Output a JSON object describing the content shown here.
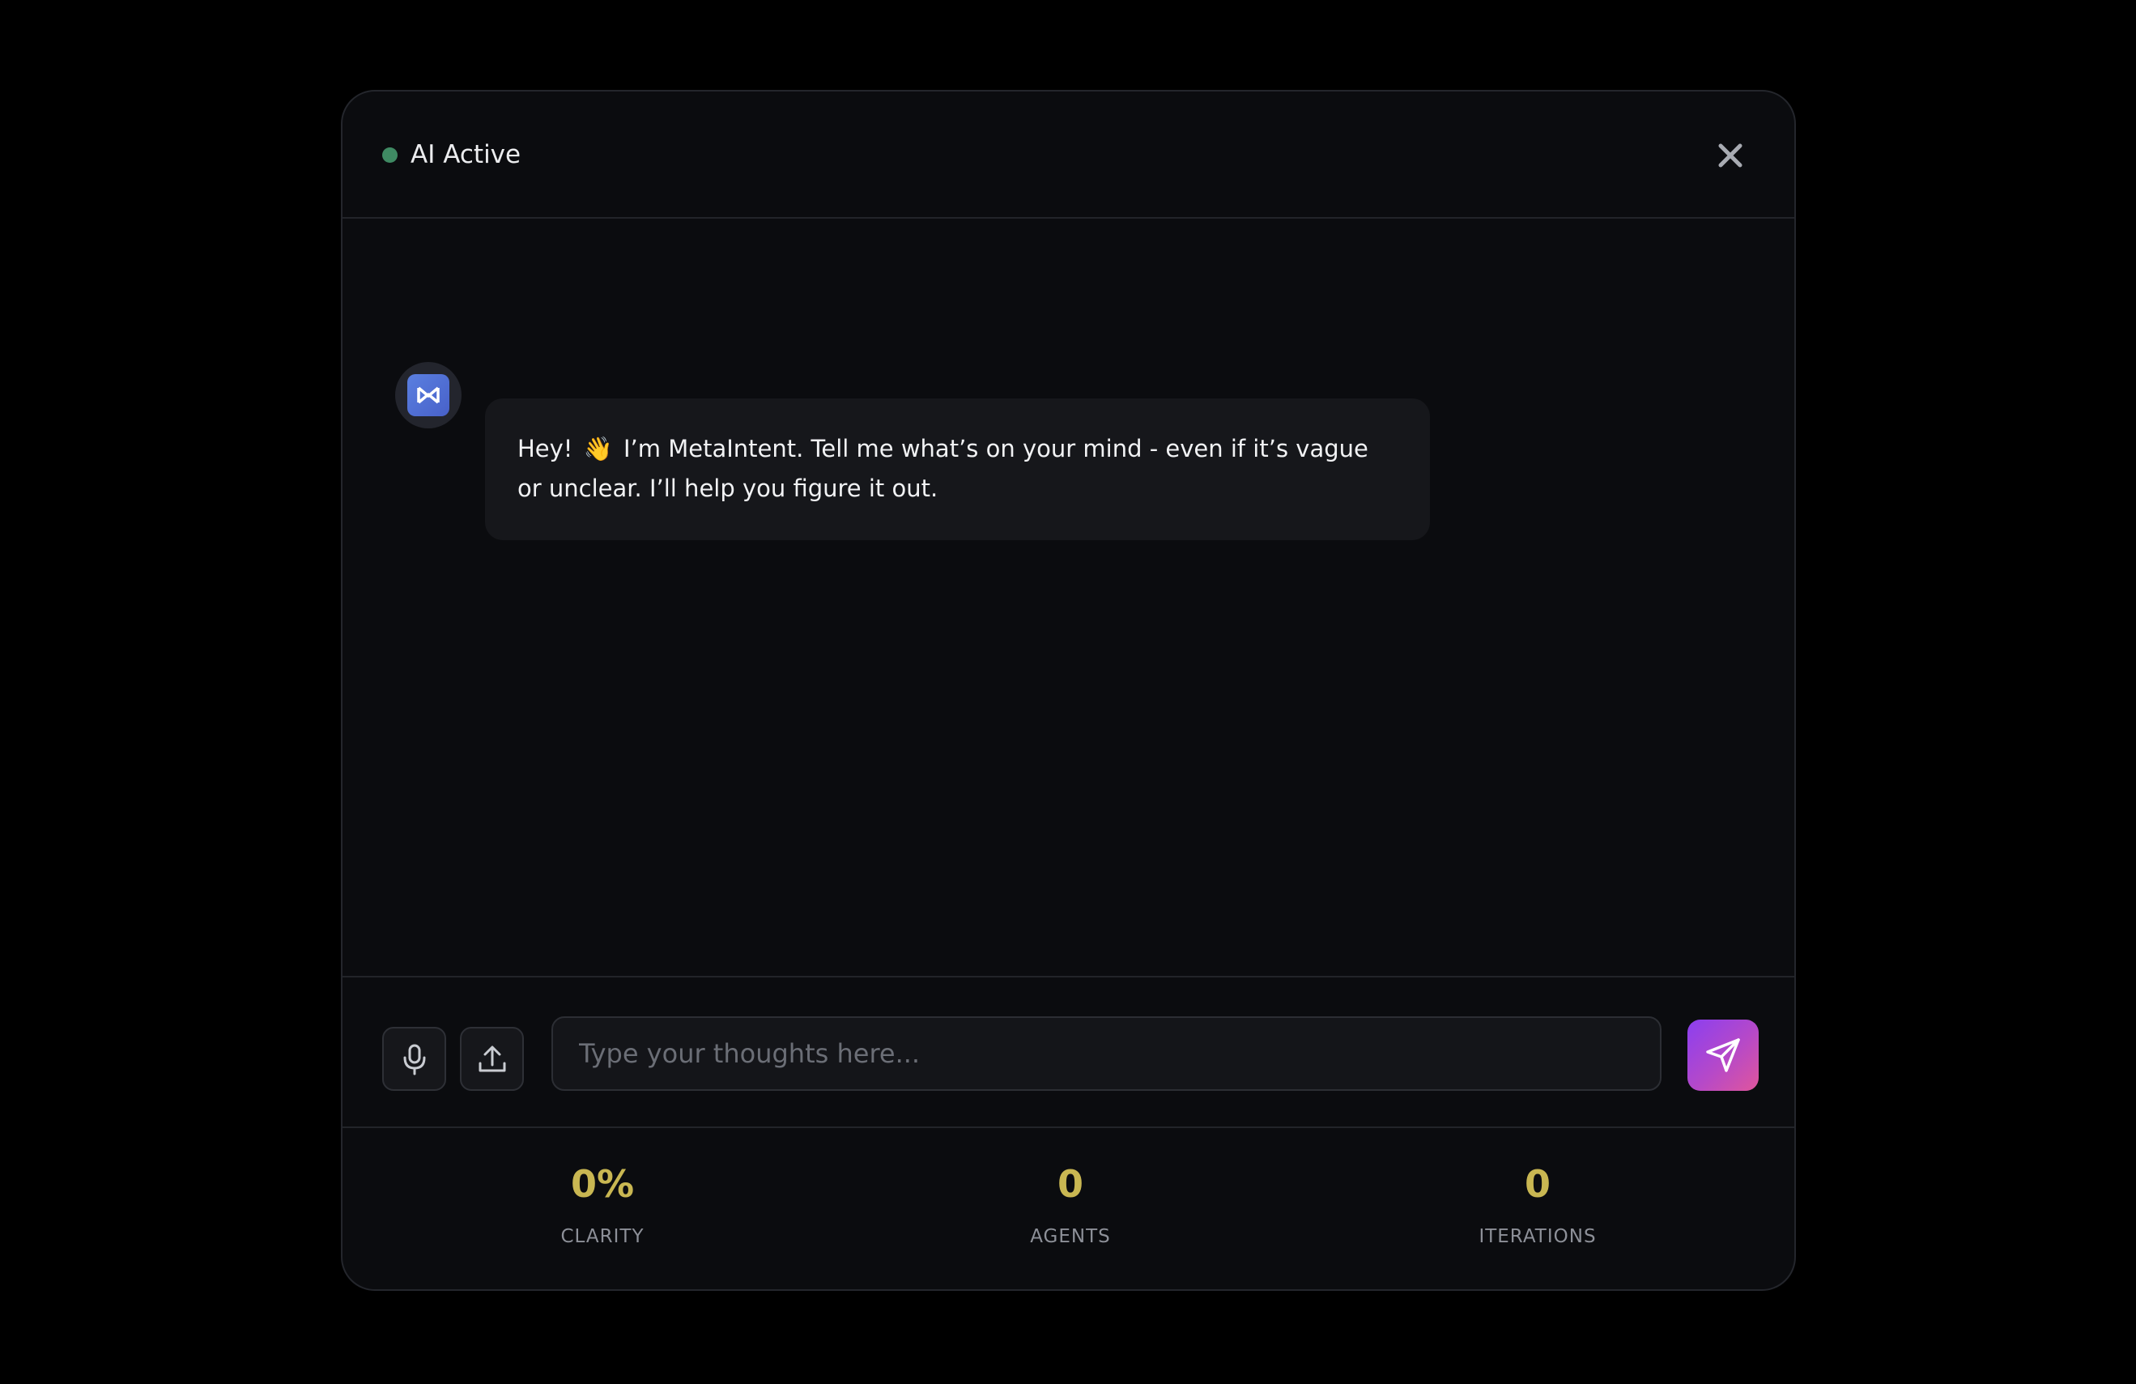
{
  "header": {
    "status_label": "AI Active",
    "status_color": "#3f8a63",
    "close_icon": "close-icon"
  },
  "messages": [
    {
      "sender": "assistant",
      "avatar_icon": "metaintent-logo-icon",
      "text_before": "Hey!",
      "emoji": "👋",
      "text_after": "I’m MetaIntent. Tell me what’s on your mind - even if it’s vague or unclear. I’ll help you figure it out."
    }
  ],
  "composer": {
    "mic_icon": "microphone-icon",
    "upload_icon": "upload-icon",
    "placeholder": "Type your thoughts here...",
    "value": "",
    "send_icon": "send-icon"
  },
  "stats": {
    "clarity": {
      "value": "0%",
      "label": "CLARITY"
    },
    "agents": {
      "value": "0",
      "label": "AGENTS"
    },
    "iterations": {
      "value": "0",
      "label": "ITERATIONS"
    }
  },
  "colors": {
    "accent_gradient_start": "#8b3ff0",
    "accent_gradient_end": "#e0569c",
    "stat_value": "#c9b752"
  }
}
